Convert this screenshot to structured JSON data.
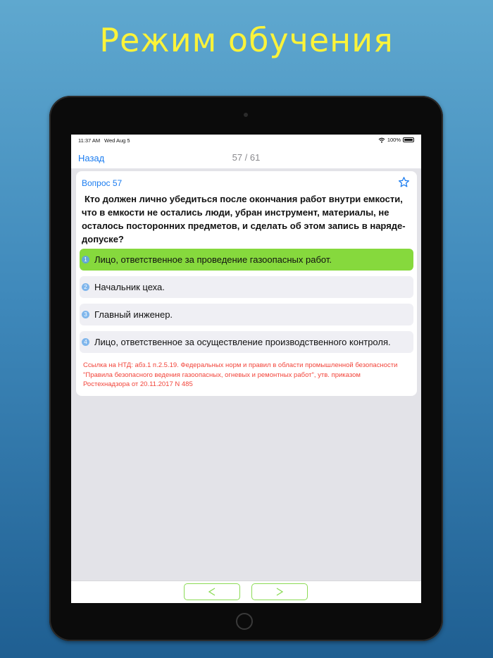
{
  "promo_title": "Режим обучения",
  "status_bar": {
    "time": "11:37 AM",
    "date": "Wed Aug 5",
    "battery": "100%"
  },
  "nav": {
    "back_label": "Назад",
    "counter": "57 / 61"
  },
  "question": {
    "label": "Вопрос 57",
    "text": "Кто должен лично убедиться после окончания работ внутри емкости, что в емкости не остались люди, убран инструмент, материалы, не осталось посторонних предметов, и сделать об этом запись в наряде-допуске?"
  },
  "answers": [
    {
      "number": "1",
      "text": "Лицо, ответственное за проведение газоопасных работ.",
      "correct": true
    },
    {
      "number": "2",
      "text": "Начальник цеха.",
      "correct": false
    },
    {
      "number": "3",
      "text": "Главный инженер.",
      "correct": false
    },
    {
      "number": "4",
      "text": "Лицо, ответственное за осуществление производственного контроля.",
      "correct": false
    }
  ],
  "reference": "Ссылка на НТД: абз.1 п.2.5.19. Федеральных норм и правил в области промышленной безопасности \"Правила безопасного ведения газоопасных, огневых и ремонтных работ\", утв. приказом Ростехнадзора от 20.11.2017 N 485",
  "colors": {
    "accent": "#1a7cf0",
    "correct": "#86d93d",
    "reference": "#f2443a",
    "title": "#fbf33a",
    "arrow_border": "#8bdb55"
  },
  "icons": {
    "favorite": "star-icon",
    "prev": "chevron-left-icon",
    "next": "chevron-right-icon",
    "wifi": "wifi-icon"
  }
}
